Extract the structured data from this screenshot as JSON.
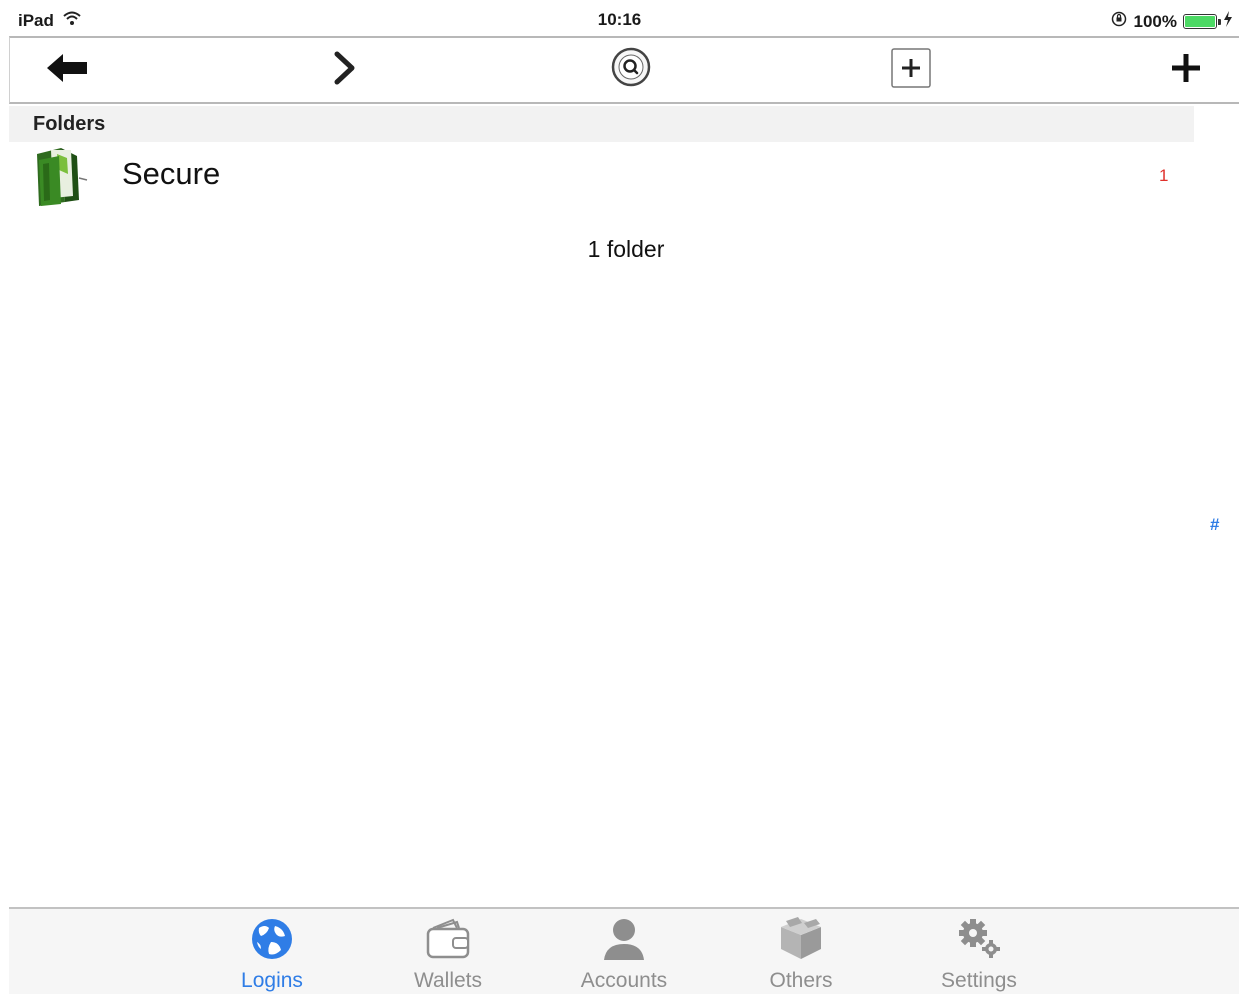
{
  "status_bar": {
    "device": "iPad",
    "time": "10:16",
    "battery_percent": "100%"
  },
  "toolbar": {
    "buttons": [
      {
        "name": "back",
        "icon": "arrow-left-icon"
      },
      {
        "name": "forward",
        "icon": "chevron-right-icon"
      },
      {
        "name": "search",
        "icon": "search-circle-icon"
      },
      {
        "name": "add-box",
        "icon": "plus-box-icon"
      },
      {
        "name": "add",
        "icon": "plus-icon"
      }
    ]
  },
  "section": {
    "title": "Folders"
  },
  "folders": [
    {
      "name": "Secure",
      "count": "1",
      "icon": "green-folder-icon"
    }
  ],
  "summary": "1 folder",
  "index": {
    "label": "#"
  },
  "tabs": [
    {
      "label": "Logins",
      "icon": "globe-icon",
      "active": true
    },
    {
      "label": "Wallets",
      "icon": "wallet-icon",
      "active": false
    },
    {
      "label": "Accounts",
      "icon": "person-icon",
      "active": false
    },
    {
      "label": "Others",
      "icon": "box-icon",
      "active": false
    },
    {
      "label": "Settings",
      "icon": "gears-icon",
      "active": false
    }
  ],
  "colors": {
    "accent": "#2f7de6",
    "badge": "#e0302b",
    "tab_inactive": "#8e8e8e",
    "section_bg": "#f2f2f2",
    "battery": "#4cd964"
  }
}
